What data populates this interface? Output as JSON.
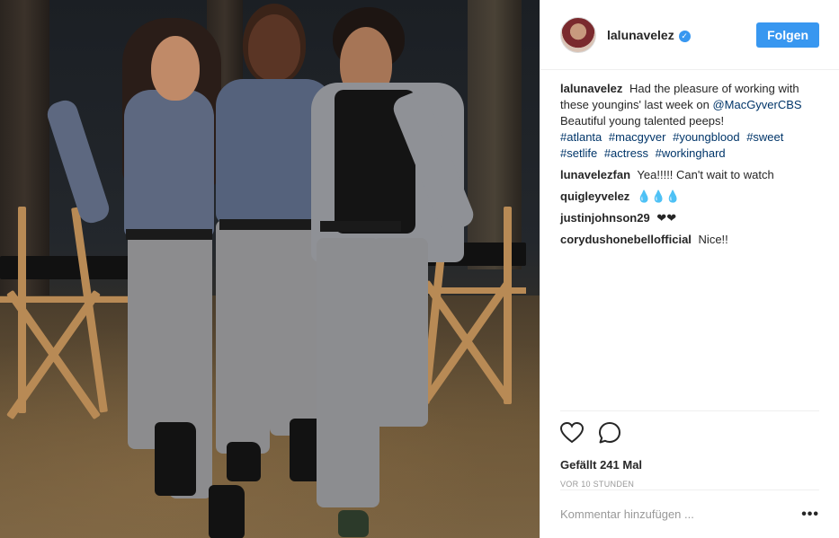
{
  "post": {
    "photo_alt": "Three people posing in grey uniforms at night among director chairs"
  },
  "header": {
    "username": "lalunavelez",
    "verified_icon": "verified-badge-icon",
    "follow_label": "Folgen"
  },
  "caption": {
    "username": "lalunavelez",
    "text_1": "Had the pleasure of working with these youngins' last week on",
    "mention": "@MacGyverCBS",
    "text_2": "Beautiful young talented peeps!",
    "hashtags": [
      "#atlanta",
      "#macgyver",
      "#youngblood",
      "#sweet",
      "#setlife",
      "#actress",
      "#workinghard"
    ]
  },
  "comments": [
    {
      "user": "lunavelezfan",
      "text": "Yea!!!!! Can't wait to watch"
    },
    {
      "user": "quigleyvelez",
      "text": "💧💧💧"
    },
    {
      "user": "justinjohnson29",
      "text": "❤❤"
    },
    {
      "user": "corydushonebellofficial",
      "text": "Nice!!"
    }
  ],
  "actions": {
    "like_icon": "heart-icon",
    "comment_icon": "speech-bubble-icon",
    "likes": "Gefällt 241 Mal",
    "timestamp": "VOR 10 STUNDEN"
  },
  "add_comment": {
    "placeholder": "Kommentar hinzufügen ...",
    "more_label": "•••"
  },
  "colors": {
    "accent": "#3897f0",
    "link": "#003569",
    "text": "#262626",
    "muted": "#999999"
  }
}
